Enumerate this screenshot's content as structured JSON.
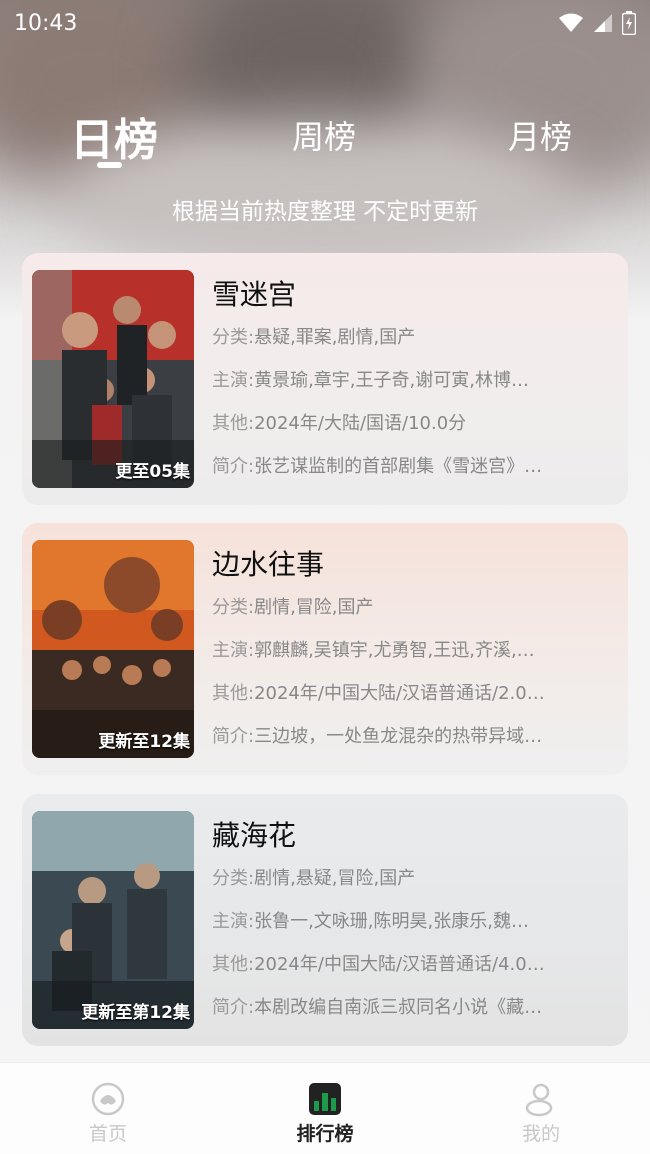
{
  "status": {
    "time": "10:43"
  },
  "tabs": [
    {
      "label": "日榜",
      "active": true
    },
    {
      "label": "周榜",
      "active": false
    },
    {
      "label": "月榜",
      "active": false
    }
  ],
  "subtitle": "根据当前热度整理 不定时更新",
  "cards": [
    {
      "title": "雪迷宫",
      "poster_tag": "更至05集",
      "category_key": "分类:",
      "category": "悬疑,罪案,剧情,国产",
      "cast_key": "主演:",
      "cast": "黄景瑜,章宇,王子奇,谢可寅,林博…",
      "other_key": "其他:",
      "other": "2024年/大陆/国语/10.0分",
      "intro_key": "简介:",
      "intro": "张艺谋监制的首部剧集《雪迷宫》…"
    },
    {
      "title": "边水往事",
      "poster_tag": "更新至12集",
      "category_key": "分类:",
      "category": "剧情,冒险,国产",
      "cast_key": "主演:",
      "cast": "郭麒麟,吴镇宇,尤勇智,王迅,齐溪,…",
      "other_key": "其他:",
      "other": "2024年/中国大陆/汉语普通话/2.0…",
      "intro_key": "简介:",
      "intro": "三边坡，一处鱼龙混杂的热带异域…"
    },
    {
      "title": "藏海花",
      "poster_tag": "更新至第12集",
      "category_key": "分类:",
      "category": "剧情,悬疑,冒险,国产",
      "cast_key": "主演:",
      "cast": "张鲁一,文咏珊,陈明昊,张康乐,魏…",
      "other_key": "其他:",
      "other": "2024年/中国大陆/汉语普通话/4.0…",
      "intro_key": "简介:",
      "intro": "本剧改编自南派三叔同名小说《藏…"
    }
  ],
  "nav": [
    {
      "label": "首页",
      "icon": "home-icon",
      "active": false
    },
    {
      "label": "排行榜",
      "icon": "ranking-icon",
      "active": true
    },
    {
      "label": "我的",
      "icon": "profile-icon",
      "active": false
    }
  ],
  "colors": {
    "accent": "#1e9b4a",
    "inactive": "#c8c8c8"
  }
}
